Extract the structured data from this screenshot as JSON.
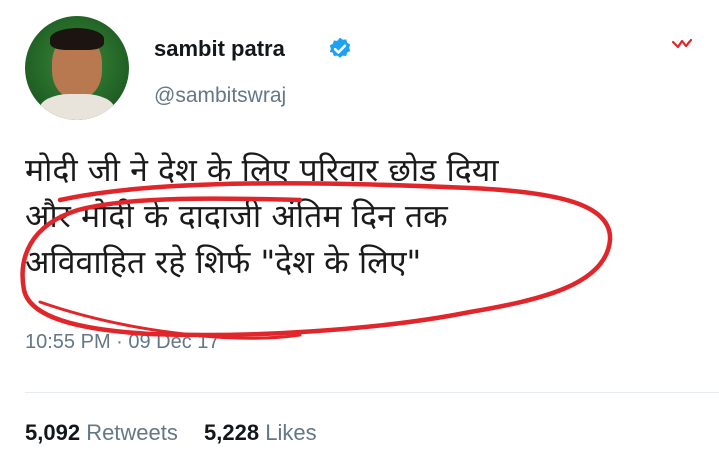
{
  "user": {
    "name": "sambit patra",
    "handle": "@sambitswraj"
  },
  "tweet": {
    "lines": [
      "मोदी जी ने देश के लिए परिवार छोड दिया",
      "और मोदी के दादाजी अंतिम दिन तक",
      "अविवाहित रहे शिर्फ \"देश के लिए\""
    ],
    "timestamp": "10:55 PM · 09 Dec 17"
  },
  "stats": {
    "retweets_count": "5,092",
    "retweets_label": "Retweets",
    "likes_count": "5,228",
    "likes_label": "Likes"
  },
  "icons": {
    "verified": "verified-badge-icon",
    "menu": "chevron-down-icon"
  },
  "colors": {
    "verified_blue": "#1da1f2",
    "handle_gray": "#657786",
    "annotation_red": "#e0262a"
  }
}
